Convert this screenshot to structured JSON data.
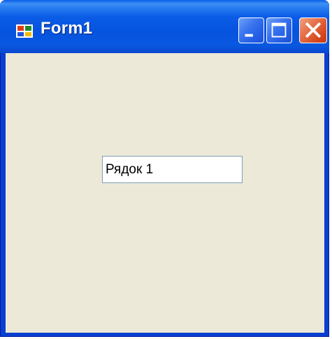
{
  "window": {
    "title": "Form1",
    "icon": "windows-form-icon",
    "controls": {
      "minimize_icon": "minimize-icon",
      "maximize_icon": "maximize-icon",
      "close_icon": "close-icon"
    }
  },
  "form": {
    "textbox": {
      "value": "Рядок 1"
    }
  },
  "colors": {
    "titlebar": "#0653df",
    "client_background": "#ece9d8",
    "close_button": "#d8481e",
    "textbox_border": "#7f9db9"
  }
}
